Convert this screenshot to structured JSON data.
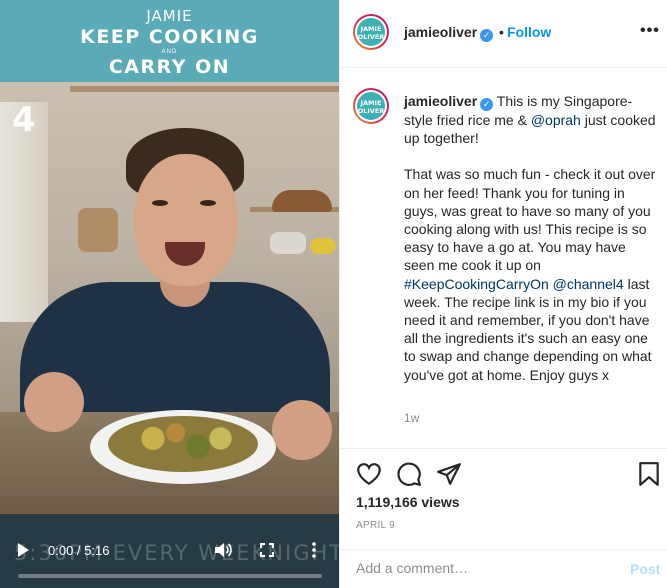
{
  "video": {
    "banner": {
      "line1": "JAMIE",
      "line2": "KEEP COOKING",
      "line3": "AND",
      "line4": "CARRY ON"
    },
    "channel_logo": "4",
    "watermark": "5:30PM EVERY WEEKNIGHT",
    "time": "0:00 / 5:16",
    "progress": 0,
    "icons": [
      "play-icon",
      "volume-icon",
      "fullscreen-icon",
      "more-vertical-icon"
    ]
  },
  "header": {
    "avatar_text": "JAMIE OLIVER",
    "username": "jamieoliver",
    "verified_glyph": "✓",
    "separator": "•",
    "follow_label": "Follow",
    "more_label": "•••"
  },
  "caption": {
    "username": "jamieoliver",
    "line1": "This is my Singapore-style fried rice me & ",
    "mention1": "@oprah",
    "line1_end": " just cooked up together!",
    "para2_start": "That was so much fun - check it out over on her feed! Thank you for tuning in guys, was great to have so many of you cooking along with us! This recipe is so easy to have a go at. You may have seen me cook it up on ",
    "hashtag": "#KeepCookingCarryOn",
    "mention2": "@channel4",
    "para2_end": " last week. The recipe link is in my bio if you need it and remember, if you don't have all the ingredients it's such an easy one to swap and change depending on what you've got at home. Enjoy guys x",
    "ago": "1w"
  },
  "actions": {
    "icons": [
      "heart-icon",
      "comment-icon",
      "share-icon",
      "bookmark-icon"
    ],
    "views": "1,119,166 views",
    "date": "APRIL 9"
  },
  "comment": {
    "placeholder": "Add a comment…",
    "post_label": "Post"
  },
  "colors": {
    "accent": "#0095f6",
    "banner": "#5aaab8",
    "verified": "#3897f0"
  }
}
